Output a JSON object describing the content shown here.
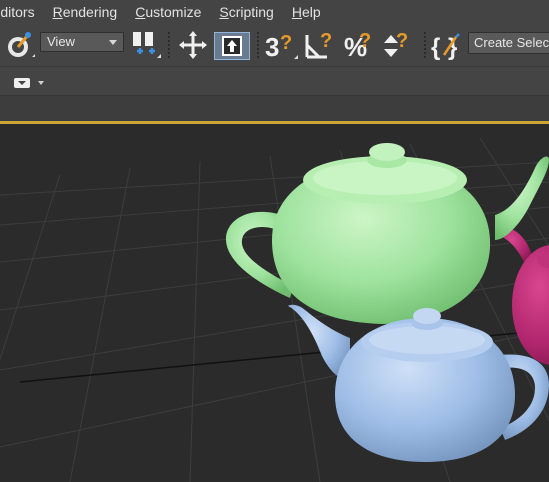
{
  "menu": {
    "items": [
      {
        "label": "Editors",
        "accel": "E"
      },
      {
        "label": "Rendering",
        "accel": "R"
      },
      {
        "label": "Customize",
        "accel": "C"
      },
      {
        "label": "Scripting",
        "accel": "S"
      },
      {
        "label": "Help",
        "accel": "H"
      }
    ]
  },
  "toolbar": {
    "view_dropdown": "View",
    "create_selection_set": "Create Selection Set",
    "icons": [
      "paint-select-icon",
      "pivot-icon",
      "move-snap-icon",
      "select-and-place-icon",
      "snap-3d-icon",
      "angle-snap-icon",
      "percent-snap-icon",
      "spinner-snap-icon",
      "edit-named-sets-icon"
    ]
  },
  "viewport": {
    "border_color": "#c9a633",
    "background": "#2b2b2b",
    "objects": [
      {
        "name": "teapot-green",
        "color": "#9fe39f"
      },
      {
        "name": "teapot-magenta",
        "color": "#b0266e"
      },
      {
        "name": "teapot-blue",
        "color": "#9dbce6"
      }
    ]
  }
}
